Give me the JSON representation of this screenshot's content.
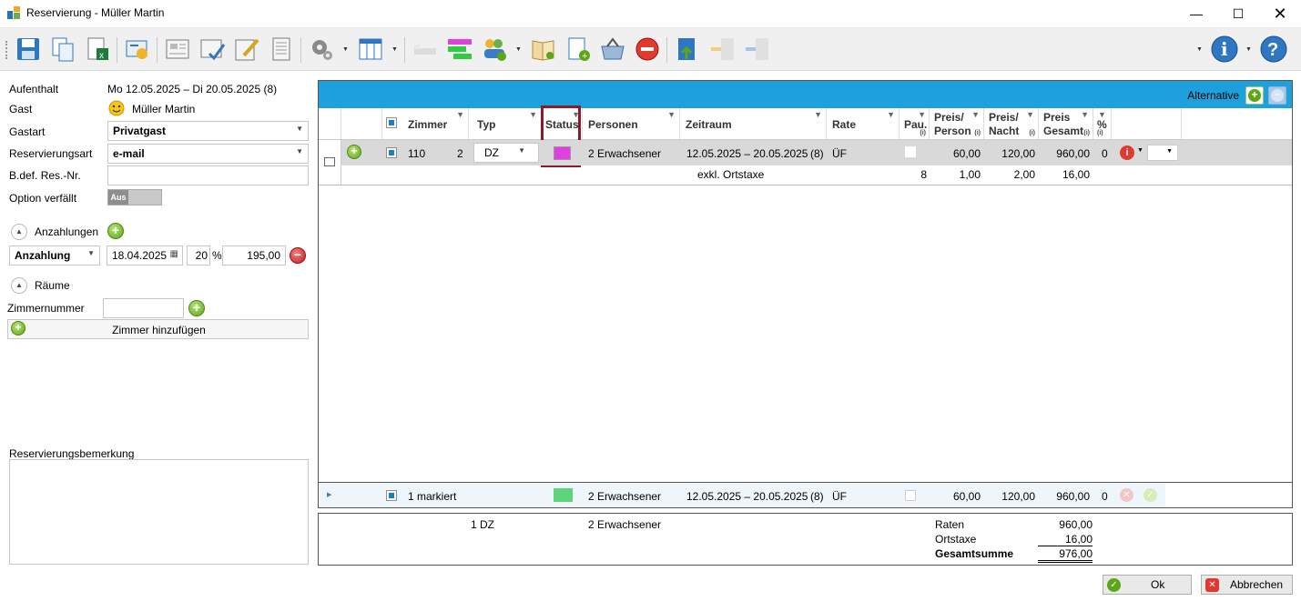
{
  "window": {
    "title": "Reservierung - Müller Martin"
  },
  "left": {
    "aufenthalt": {
      "label": "Aufenthalt",
      "value": "Mo 12.05.2025 – Di 20.05.2025 (8)"
    },
    "gast": {
      "label": "Gast",
      "value": "Müller Martin"
    },
    "gastart": {
      "label": "Gastart",
      "value": "Privatgast"
    },
    "reservierungsart": {
      "label": "Reservierungsart",
      "value": "e-mail"
    },
    "bdef": {
      "label": "B.def. Res.-Nr.",
      "value": ""
    },
    "option": {
      "label": "Option verfällt",
      "toggle": "Aus"
    },
    "anzahlungen": {
      "label": "Anzahlungen",
      "type": "Anzahlung",
      "date": "18.04.2025",
      "percent": "20",
      "percent_sign": "%",
      "amount": "195,00"
    },
    "raeume": {
      "label": "Räume",
      "zimmernummer_label": "Zimmernummer",
      "zimmernummer_value": "",
      "add_label": "Zimmer hinzufügen"
    },
    "bemerkung": {
      "label": "Reservierungsbemerkung",
      "value": ""
    }
  },
  "grid": {
    "alternative": "Alternative",
    "headers": {
      "zimmer": "Zimmer",
      "typ": "Typ",
      "status": "Status",
      "personen": "Personen",
      "zeitraum": "Zeitraum",
      "rate": "Rate",
      "pau": "Pau.",
      "preis_person_1": "Preis/",
      "preis_person_2": "Person",
      "preis_nacht_1": "Preis/",
      "preis_nacht_2": "Nacht",
      "preis_gesamt_1": "Preis",
      "preis_gesamt_2": "Gesamt",
      "pct": "%",
      "info": "(i)"
    },
    "row": {
      "zimmer": "110",
      "bett": "2",
      "typ": "DZ",
      "status_color": "#e040e0",
      "personen": "2 Erwachsener",
      "zeitraum": "12.05.2025 – 20.05.2025",
      "naechte": "(8)",
      "rate": "ÜF",
      "preis_person": "60,00",
      "preis_nacht": "120,00",
      "preis_gesamt": "960,00",
      "pct": "0"
    },
    "subrow": {
      "label": "exkl. Ortstaxe",
      "pau": "8",
      "preis_person": "1,00",
      "preis_nacht": "2,00",
      "preis_gesamt": "16,00"
    },
    "footer": {
      "markiert": "1 markiert",
      "status_color": "#5ed47a",
      "personen": "2 Erwachsener",
      "zeitraum": "12.05.2025 – 20.05.2025",
      "naechte": "(8)",
      "rate": "ÜF",
      "preis_person": "60,00",
      "preis_nacht": "120,00",
      "preis_gesamt": "960,00",
      "pct": "0"
    }
  },
  "summary": {
    "typ": "1 DZ",
    "personen": "2 Erwachsener",
    "raten_label": "Raten",
    "raten_value": "960,00",
    "ortstaxe_label": "Ortstaxe",
    "ortstaxe_value": "16,00",
    "gesamt_label": "Gesamtsumme",
    "gesamt_value": "976,00"
  },
  "buttons": {
    "ok": "Ok",
    "abbrechen": "Abbrechen"
  }
}
